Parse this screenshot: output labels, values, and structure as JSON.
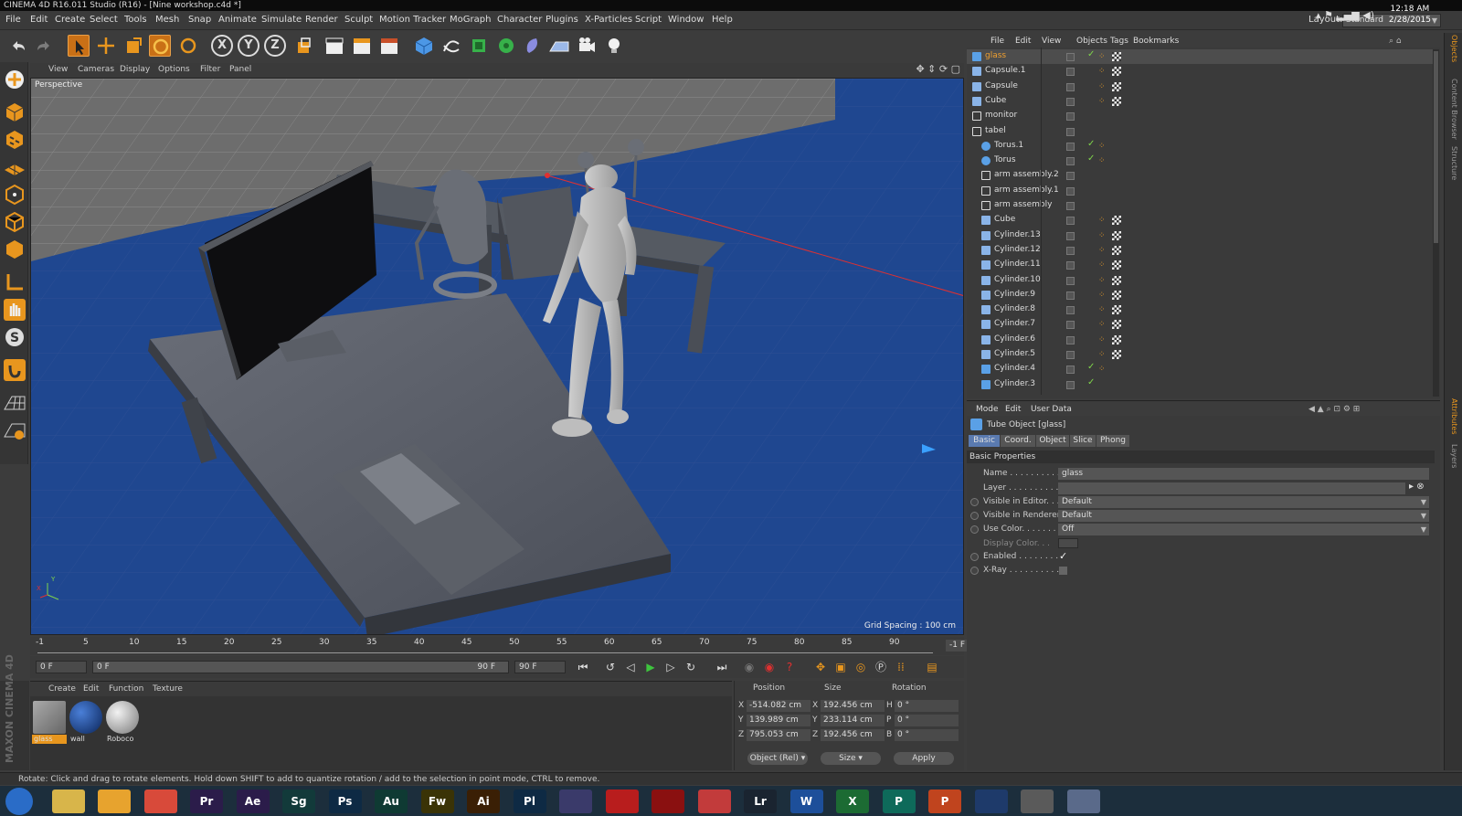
{
  "window": {
    "title": "CINEMA 4D R16.011 Studio (R16) - [Nine workshop.c4d *]"
  },
  "menubar": {
    "items": [
      "File",
      "Edit",
      "Create",
      "Select",
      "Tools",
      "Mesh",
      "Snap",
      "Animate",
      "Simulate",
      "Render",
      "Sculpt",
      "Motion Tracker",
      "MoGraph",
      "Character",
      "Plugins",
      "X-Particles",
      "Script",
      "Window",
      "Help"
    ],
    "layout_label": "Layout:",
    "layout_value": "Standard"
  },
  "toolbar": {
    "axis_x": "X",
    "axis_y": "Y",
    "axis_z": "Z"
  },
  "viewport": {
    "menu": [
      "View",
      "Cameras",
      "Display",
      "Options",
      "Filter",
      "Panel"
    ],
    "camera_label": "Perspective",
    "grid_spacing": "Grid Spacing : 100 cm"
  },
  "timeline": {
    "ticks": [
      "-1",
      "5",
      "10",
      "15",
      "20",
      "25",
      "30",
      "35",
      "40",
      "45",
      "50",
      "55",
      "60",
      "65",
      "70",
      "75",
      "80",
      "85",
      "90"
    ],
    "end_frame_display": "-1 F"
  },
  "transport": {
    "current_frame": "0 F",
    "min_frame": "0 F",
    "slider_start": "0 F",
    "slider_end": "90 F",
    "max_frame": "90 F"
  },
  "materials": {
    "menu": [
      "Create",
      "Edit",
      "Function",
      "Texture"
    ],
    "items": [
      {
        "name": "glass",
        "color": "#8a8a8a"
      },
      {
        "name": "wall",
        "color": "#1d4a9a"
      },
      {
        "name": "Roboco",
        "color": "#c4c4c4"
      }
    ]
  },
  "brand": {
    "text": "MAXON CINEMA 4D"
  },
  "coordinates": {
    "headers": [
      "Position",
      "Size",
      "Rotation"
    ],
    "rows": [
      {
        "axis": "X",
        "pos": "-514.082 cm",
        "size_axis": "X",
        "size": "192.456 cm",
        "rot_axis": "H",
        "rot": "0 °"
      },
      {
        "axis": "Y",
        "pos": "139.989 cm",
        "size_axis": "Y",
        "size": "233.114 cm",
        "rot_axis": "P",
        "rot": "0 °"
      },
      {
        "axis": "Z",
        "pos": "795.053 cm",
        "size_axis": "Z",
        "size": "192.456 cm",
        "rot_axis": "B",
        "rot": "0 °"
      }
    ],
    "mode_select": "Object (Rel)",
    "size_select": "Size",
    "apply_label": "Apply"
  },
  "status": {
    "text": "Rotate: Click and drag to rotate elements. Hold down SHIFT to add to quantize rotation / add to the selection in point mode, CTRL to remove."
  },
  "objects_panel": {
    "menu": [
      "File",
      "Edit",
      "View",
      "Objects",
      "Tags",
      "Bookmarks"
    ],
    "items": [
      {
        "name": "glass",
        "indent": 0,
        "selected": true,
        "icon": "tube-icon",
        "check": "✓",
        "tags": "both"
      },
      {
        "name": "Capsule.1",
        "indent": 0,
        "icon": "polygon-icon",
        "check": "",
        "tags": "both"
      },
      {
        "name": "Capsule",
        "indent": 0,
        "icon": "polygon-icon",
        "check": "",
        "tags": "both"
      },
      {
        "name": "Cube",
        "indent": 0,
        "icon": "polygon-icon",
        "check": "",
        "tags": "both"
      },
      {
        "name": "monitor",
        "indent": 0,
        "icon": "null-icon",
        "check": "",
        "tags": "none"
      },
      {
        "name": "tabel",
        "indent": 0,
        "icon": "null-icon",
        "check": "",
        "tags": "none"
      },
      {
        "name": "Torus.1",
        "indent": 1,
        "icon": "torus-icon",
        "check": "✓",
        "tags": "one"
      },
      {
        "name": "Torus",
        "indent": 1,
        "icon": "torus-icon",
        "check": "✓",
        "tags": "one"
      },
      {
        "name": "arm assembly.2",
        "indent": 1,
        "icon": "null-icon",
        "check": "",
        "tags": "none"
      },
      {
        "name": "arm assembly.1",
        "indent": 1,
        "icon": "null-icon",
        "check": "",
        "tags": "none"
      },
      {
        "name": "arm assembly",
        "indent": 1,
        "icon": "null-icon",
        "check": "",
        "tags": "none"
      },
      {
        "name": "Cube",
        "indent": 1,
        "icon": "polygon-icon",
        "check": "",
        "tags": "both"
      },
      {
        "name": "Cylinder.13",
        "indent": 1,
        "icon": "polygon-icon",
        "check": "",
        "tags": "both"
      },
      {
        "name": "Cylinder.12",
        "indent": 1,
        "icon": "polygon-icon",
        "check": "",
        "tags": "both"
      },
      {
        "name": "Cylinder.11",
        "indent": 1,
        "icon": "polygon-icon",
        "check": "",
        "tags": "both"
      },
      {
        "name": "Cylinder.10",
        "indent": 1,
        "icon": "polygon-icon",
        "check": "",
        "tags": "both"
      },
      {
        "name": "Cylinder.9",
        "indent": 1,
        "icon": "polygon-icon",
        "check": "",
        "tags": "both"
      },
      {
        "name": "Cylinder.8",
        "indent": 1,
        "icon": "polygon-icon",
        "check": "",
        "tags": "both"
      },
      {
        "name": "Cylinder.7",
        "indent": 1,
        "icon": "polygon-icon",
        "check": "",
        "tags": "both"
      },
      {
        "name": "Cylinder.6",
        "indent": 1,
        "icon": "polygon-icon",
        "check": "",
        "tags": "both"
      },
      {
        "name": "Cylinder.5",
        "indent": 1,
        "icon": "polygon-icon",
        "check": "",
        "tags": "both"
      },
      {
        "name": "Cylinder.4",
        "indent": 1,
        "icon": "cylinder-icon",
        "check": "✓",
        "tags": "one"
      },
      {
        "name": "Cylinder.3",
        "indent": 1,
        "icon": "cylinder-icon",
        "check": "✓",
        "tags": "none"
      }
    ]
  },
  "attributes": {
    "menu": [
      "Mode",
      "Edit",
      "User Data"
    ],
    "title": "Tube Object [glass]",
    "tabs": [
      "Basic",
      "Coord.",
      "Object",
      "Slice",
      "Phong"
    ],
    "section": "Basic Properties",
    "name_label": "Name . . . . . . . . . . . . .",
    "name_value": "glass",
    "layer_label": "Layer . . . . . . . . . . . . .",
    "visible_editor_label": "Visible in Editor. . .",
    "visible_editor_value": "Default",
    "visible_renderer_label": "Visible in Renderer",
    "visible_renderer_value": "Default",
    "use_color_label": "Use Color. . . . . . . .",
    "use_color_value": "Off",
    "display_color_label": "Display Color. . .",
    "enabled_label": "Enabled . . . . . . . . .",
    "xray_label": "X-Ray . . . . . . . . . . ."
  },
  "right_strip": [
    "Objects",
    "Content Browser",
    "Structure",
    "Attributes",
    "Layers"
  ],
  "taskbar": {
    "apps": [
      {
        "label": "",
        "name": "start-button",
        "color": "#2a6cc7"
      },
      {
        "label": "",
        "name": "explorer-icon",
        "color": "#d8b54a"
      },
      {
        "label": "",
        "name": "media-player-icon",
        "color": "#e7a32e"
      },
      {
        "label": "",
        "name": "chrome-icon",
        "color": "#d84a3a"
      },
      {
        "label": "Pr",
        "name": "premiere-icon",
        "color": "#2b1c4a"
      },
      {
        "label": "Ae",
        "name": "after-effects-icon",
        "color": "#2b1c4a"
      },
      {
        "label": "Sg",
        "name": "speedgrade-icon",
        "color": "#123a3a"
      },
      {
        "label": "Ps",
        "name": "photoshop-icon",
        "color": "#0e2a44"
      },
      {
        "label": "Au",
        "name": "audition-icon",
        "color": "#0f3a33"
      },
      {
        "label": "Fw",
        "name": "fireworks-icon",
        "color": "#3a3306"
      },
      {
        "label": "Ai",
        "name": "illustrator-icon",
        "color": "#3a1f05"
      },
      {
        "label": "Pl",
        "name": "prelude-icon",
        "color": "#0e2a44"
      },
      {
        "label": "",
        "name": "app-icon",
        "color": "#3a3a6a"
      },
      {
        "label": "",
        "name": "acrobat-reader-icon",
        "color": "#b81d1d"
      },
      {
        "label": "",
        "name": "acrobat-icon",
        "color": "#8a1010"
      },
      {
        "label": "",
        "name": "resolve-icon",
        "color": "#c23b3b"
      },
      {
        "label": "Lr",
        "name": "lightroom-icon",
        "color": "#1a2430"
      },
      {
        "label": "W",
        "name": "word-icon",
        "color": "#1d4f9a"
      },
      {
        "label": "X",
        "name": "excel-icon",
        "color": "#1c6b33"
      },
      {
        "label": "P",
        "name": "publisher-icon",
        "color": "#0e6a5a"
      },
      {
        "label": "P",
        "name": "powerpoint-icon",
        "color": "#c0441e"
      },
      {
        "label": "",
        "name": "cinema4d-icon",
        "color": "#1e3a6a"
      },
      {
        "label": "",
        "name": "zbrush-icon",
        "color": "#5a5a5a"
      },
      {
        "label": "",
        "name": "app2-icon",
        "color": "#5a6a8a"
      }
    ],
    "time": "12:18 AM",
    "date": "2/28/2015"
  },
  "colors": {
    "accent": "#d8851f",
    "selection": "#5a7ab0",
    "check": "#7fd44b",
    "floor": "#1d4590"
  }
}
